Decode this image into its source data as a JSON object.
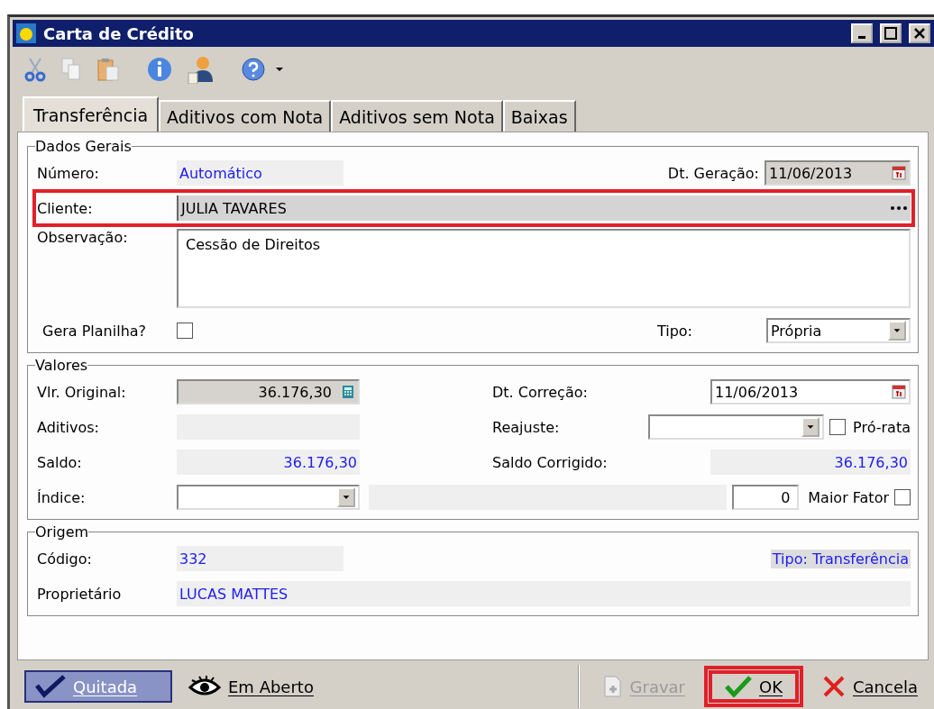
{
  "window": {
    "title": "Carta de Crédito"
  },
  "tabs": [
    {
      "label": "Transferência",
      "selected": true
    },
    {
      "label": "Aditivos com Nota",
      "selected": false
    },
    {
      "label": "Aditivos sem Nota",
      "selected": false
    },
    {
      "label": "Baixas",
      "selected": false
    }
  ],
  "dados_gerais": {
    "title": "Dados Gerais",
    "numero": {
      "label": "Número:",
      "value": "Automático"
    },
    "dt_geracao": {
      "label": "Dt. Geração:",
      "value": "11/06/2013"
    },
    "cliente": {
      "label": "Cliente:",
      "value": "JULIA TAVARES",
      "highlighted": true
    },
    "observacao": {
      "label": "Observação:",
      "value": "Cessão de Direitos"
    },
    "gera_planilha": {
      "label": "Gera Planilha?",
      "checked": false
    },
    "tipo": {
      "label": "Tipo:",
      "value": "Própria"
    }
  },
  "valores": {
    "title": "Valores",
    "vlr_original": {
      "label": "Vlr. Original:",
      "value": "36.176,30"
    },
    "dt_correcao": {
      "label": "Dt. Correção:",
      "value": "11/06/2013"
    },
    "aditivos": {
      "label": "Aditivos:"
    },
    "reajuste": {
      "label": "Reajuste:"
    },
    "pro_rata": {
      "label": "Pró-rata",
      "checked": false
    },
    "saldo": {
      "label": "Saldo:",
      "value": "36.176,30"
    },
    "saldo_corrigido": {
      "label": "Saldo Corrigido:",
      "value": "36.176,30"
    },
    "indice": {
      "label": "Índice:"
    },
    "fator": {
      "value": "0"
    },
    "maior_fator": {
      "label": "Maior Fator",
      "checked": false
    }
  },
  "origem": {
    "title": "Origem",
    "codigo": {
      "label": "Código:",
      "value": "332"
    },
    "tipo": {
      "value": "Tipo: Transferência"
    },
    "proprietario": {
      "label": "Proprietário",
      "value": "LUCAS MATTES"
    }
  },
  "buttons": [
    {
      "label": "Quitada",
      "kind": "check",
      "pressed": true,
      "disabled": false,
      "highlighted": false
    },
    {
      "label": "Em Aberto",
      "kind": "eye",
      "pressed": false,
      "disabled": false,
      "highlighted": false
    },
    {
      "label": "Gravar",
      "kind": "add",
      "pressed": false,
      "disabled": true,
      "highlighted": false
    },
    {
      "label": "OK",
      "kind": "ok",
      "pressed": false,
      "disabled": false,
      "highlighted": true
    },
    {
      "label": "Cancela",
      "kind": "cancel",
      "pressed": false,
      "disabled": false,
      "highlighted": false
    }
  ]
}
